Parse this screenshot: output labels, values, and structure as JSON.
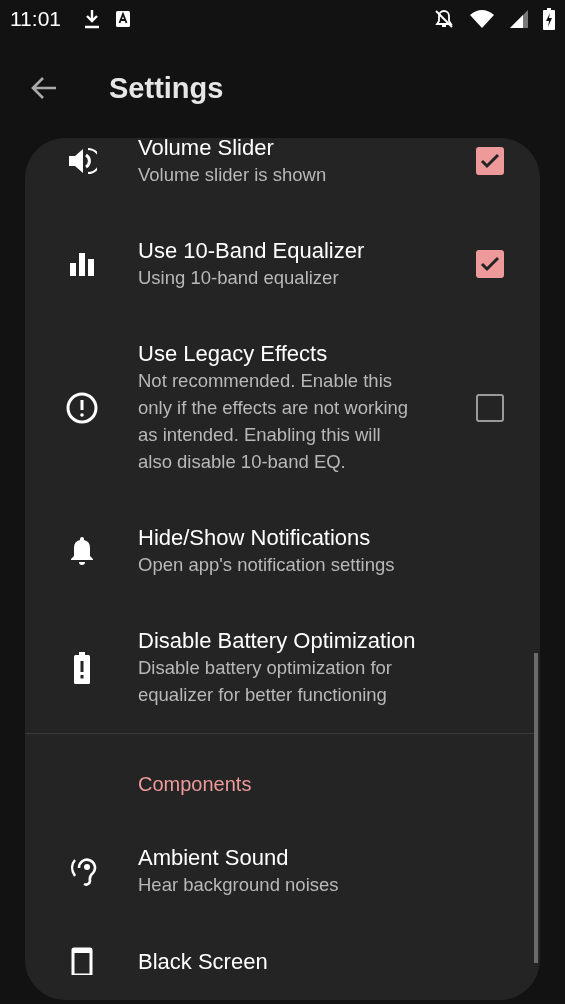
{
  "status_bar": {
    "time": "11:01"
  },
  "toolbar": {
    "title": "Settings"
  },
  "items": [
    {
      "kind": "checkbox",
      "title": "Volume Slider",
      "summary": "Volume slider is shown",
      "checked": true
    },
    {
      "kind": "checkbox",
      "title": "Use 10-Band Equalizer",
      "summary": "Using 10-band equalizer",
      "checked": true
    },
    {
      "kind": "checkbox",
      "title": "Use Legacy Effects",
      "summary": "Not recommended. Enable this only if the effects are not working as intended. Enabling this will also disable 10-band EQ.",
      "checked": false
    },
    {
      "kind": "link",
      "title": "Hide/Show Notifications",
      "summary": "Open app's notification settings"
    },
    {
      "kind": "link",
      "title": "Disable Battery Optimization",
      "summary": "Disable battery optimization for equalizer for better functioning"
    },
    {
      "kind": "divider"
    },
    {
      "kind": "header",
      "title": "Components"
    },
    {
      "kind": "link",
      "title": "Ambient Sound",
      "summary": "Hear background noises"
    },
    {
      "kind": "link",
      "title": "Black Screen"
    }
  ]
}
